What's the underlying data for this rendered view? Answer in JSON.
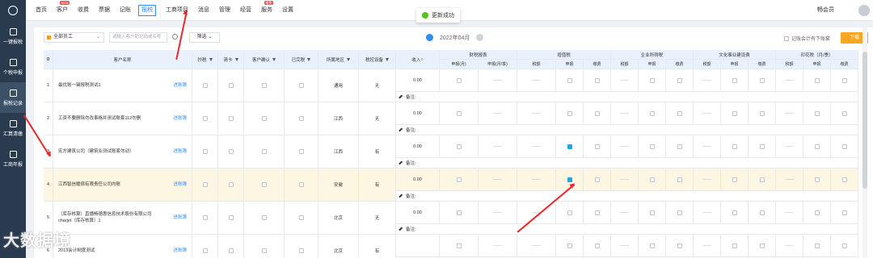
{
  "sidebar": {
    "items": [
      {
        "label": "一键报税",
        "icon": "monitor-icon"
      },
      {
        "label": "个税申报",
        "icon": "upload-icon"
      },
      {
        "label": "报税记录",
        "icon": "record-icon"
      },
      {
        "label": "汇算清缴",
        "icon": "percent-icon"
      },
      {
        "label": "工商年报",
        "icon": "calendar-icon"
      }
    ],
    "active_index": 2
  },
  "topnav": {
    "items": [
      {
        "label": "首页",
        "badge": ""
      },
      {
        "label": "客户",
        "badge": "NEW"
      },
      {
        "label": "收费",
        "badge": ""
      },
      {
        "label": "票据",
        "badge": ""
      },
      {
        "label": "记账",
        "badge": ""
      },
      {
        "label": "报税",
        "badge": ""
      },
      {
        "label": "工商项目",
        "badge": ""
      },
      {
        "label": "消息",
        "badge": ""
      },
      {
        "label": "管理",
        "badge": ""
      },
      {
        "label": "经营",
        "badge": ""
      },
      {
        "label": "服务",
        "badge": "限免"
      },
      {
        "label": "设置",
        "badge": ""
      }
    ],
    "active_index": 5,
    "member_label": "畅会员"
  },
  "toast": {
    "text": "更新成功"
  },
  "toolbar": {
    "staff_select": "全部员工",
    "search_placeholder": "请输入客户助记码或名称",
    "filter_label": "筛选",
    "month": "2022年04月",
    "no_accountant_label": "记账会计有下账套",
    "download_label": "下载"
  },
  "table": {
    "headers": {
      "index": "",
      "name": "客户名称",
      "copy_tax": "抄税",
      "clear_card": "清卡",
      "customer_confirm": "客户确认",
      "completed": "已完税",
      "region": "所属地区",
      "tax_device": "税控设备",
      "income": "收入",
      "groups": [
        {
          "label": "财税报表",
          "subs": [
            "申报(月)",
            "申报(月/季)"
          ]
        },
        {
          "label": "增值税",
          "subs": [
            "税额",
            "申报",
            "缴费"
          ]
        },
        {
          "label": "企业所得税",
          "subs": [
            "税额",
            "申报",
            "缴费"
          ]
        },
        {
          "label": "文化事业建设费",
          "subs": [
            "税额",
            "申报",
            "缴费"
          ]
        },
        {
          "label": "印花税（月/季）",
          "subs": [
            "税额",
            "申报",
            "缴费"
          ]
        }
      ]
    },
    "note_label": "备注:",
    "rows": [
      {
        "index": "1",
        "name": "最优账一键报税测试1",
        "link": "进账簿",
        "region": "通用",
        "tax_device": "无",
        "income": "0.00",
        "vat_declared": false
      },
      {
        "index": "2",
        "name": "工资不要删除勿改事格并测试账套112勿删",
        "link": "进账簿",
        "region": "江西",
        "tax_device": "无",
        "income": "0.00",
        "vat_declared": false
      },
      {
        "index": "3",
        "name": "宏方建筑公司（建筑业测试账套勿动）",
        "link": "进账簿",
        "region": "江西",
        "tax_device": "有",
        "income": "0.00",
        "vat_declared": true
      },
      {
        "index": "4",
        "name": "江西智信暖宿有限责任公司内账",
        "link": "进账簿",
        "region": "安徽",
        "tax_device": "有",
        "income": "0.00",
        "vat_declared": true
      },
      {
        "index": "5",
        "name": "（库存核算）直播畅德惠信息技术股份有限公司charjet（库存核算）1",
        "link": "进账簿",
        "region": "北京",
        "tax_device": "无",
        "income": "0.00",
        "vat_declared": false
      },
      {
        "index": "6",
        "name": "2013会计制度测试",
        "link": "进账簿",
        "region": "北京",
        "tax_device": "有",
        "income": "",
        "vat_declared": false
      }
    ],
    "highlight_index": 3,
    "dash": "——"
  },
  "watermark": "大数据境",
  "colors": {
    "accent": "#2e8ef7",
    "sidebar": "#2a3b4f",
    "download": "#f5a623",
    "arrow": "#e8282a",
    "highlight_row": "#fdf6e3"
  }
}
